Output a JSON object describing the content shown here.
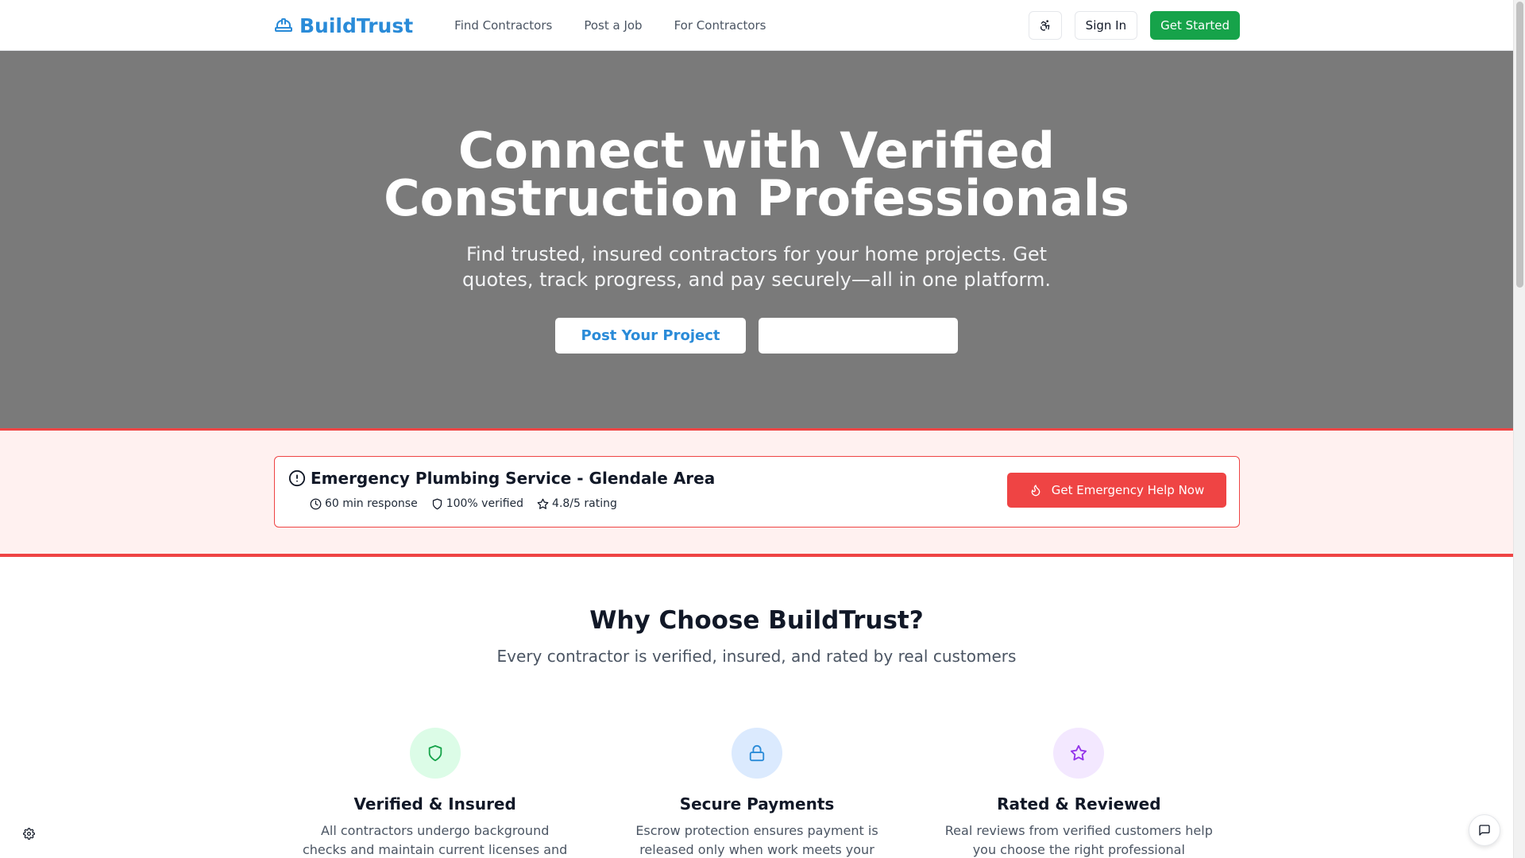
{
  "brand": {
    "name": "BuildTrust",
    "color": "#2a8bd8",
    "icon": "hard-hat-icon"
  },
  "nav": {
    "items": [
      "Find Contractors",
      "Post a Job",
      "For Contractors"
    ]
  },
  "header": {
    "accessibility_icon": "accessibility-icon",
    "signin_label": "Sign In",
    "get_started_label": "Get Started"
  },
  "hero": {
    "title_line1": "Connect with Verified",
    "title_line2": "Construction Professionals",
    "subtitle": "Find trusted, insured contractors for your home projects. Get quotes, track progress, and pay securely—all in one platform.",
    "post_button": "Post Your Project",
    "secondary_button": ""
  },
  "emergency": {
    "icon": "alert-circle-icon",
    "title": "Emergency Plumbing Service - Glendale Area",
    "stats": [
      {
        "icon": "clock-icon",
        "label": "60 min response"
      },
      {
        "icon": "shield-icon",
        "label": "100% verified"
      },
      {
        "icon": "star-icon",
        "label": "4.8/5 rating"
      }
    ],
    "button_icon": "flame-icon",
    "button_label": "Get Emergency Help Now",
    "accent": "#ef4444"
  },
  "why": {
    "title": "Why Choose BuildTrust?",
    "subtitle": "Every contractor is verified, insured, and rated by real customers",
    "features": [
      {
        "icon": "shield-icon",
        "title": "Verified & Insured",
        "desc": "All contractors undergo background checks and maintain current licenses and",
        "bg": "#dcfce7",
        "fg": "#16a34a"
      },
      {
        "icon": "lock-icon",
        "title": "Secure Payments",
        "desc": "Escrow protection ensures payment is released only when work meets your",
        "bg": "#dbeafe",
        "fg": "#2a8bd8"
      },
      {
        "icon": "star-icon",
        "title": "Rated & Reviewed",
        "desc": "Real reviews from verified customers help you choose the right professional",
        "bg": "#f3e8ff",
        "fg": "#9333ea"
      }
    ]
  },
  "floating": {
    "settings_icon": "gear-icon",
    "chat_icon": "chat-icon"
  }
}
